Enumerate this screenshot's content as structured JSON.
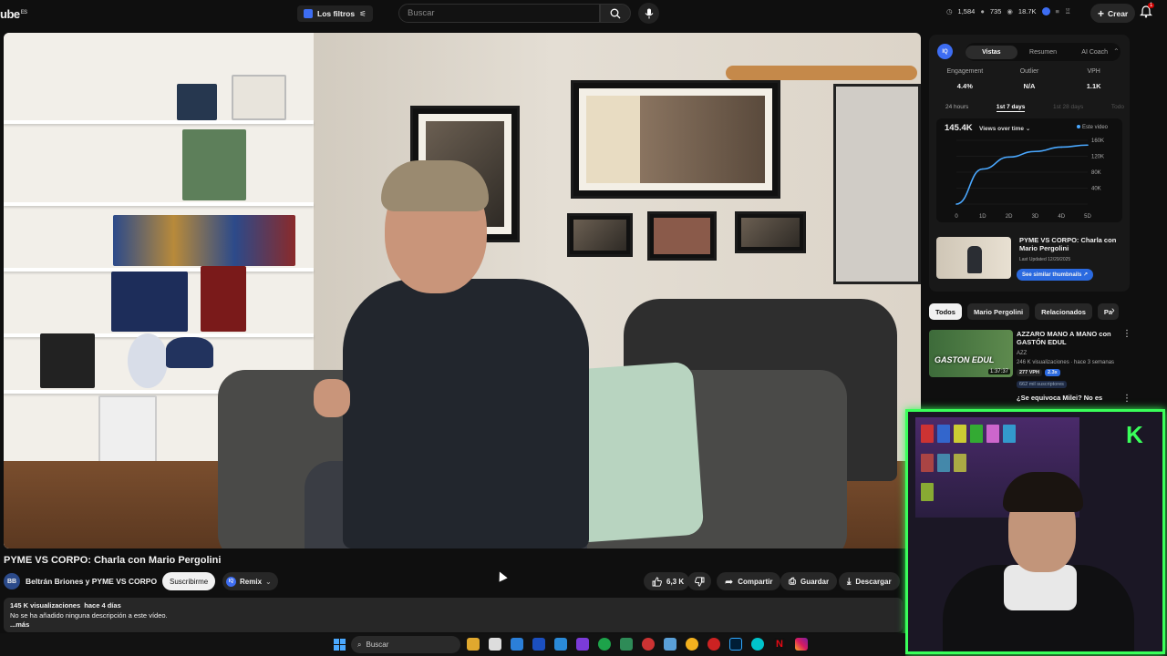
{
  "topbar": {
    "logo": "ube",
    "logo_region": "ES",
    "filters_label": "Los filtros",
    "search_placeholder": "Buscar",
    "stats": [
      "1,584",
      "735",
      "18.7K"
    ],
    "create_label": "Crear",
    "notifications_count": "1"
  },
  "video": {
    "title": "PYME VS CORPO: Charla con Mario Pergolini",
    "channel": "Beltrán Briones y PYME VS CORPO",
    "subscribe_label": "Suscribirme",
    "remix_label": "Remix",
    "likes": "6,3 K",
    "share_label": "Compartir",
    "save_label": "Guardar",
    "download_label": "Descargar"
  },
  "description": {
    "views": "145 K visualizaciones",
    "age": "hace 4 días",
    "text": "No se ha añadido ninguna descripción a este vídeo.",
    "more": "...más"
  },
  "panel": {
    "icon_label": "IQ",
    "tabs": [
      "Vistas",
      "Resumen",
      "AI Coach"
    ],
    "metrics": [
      {
        "label": "Engagement",
        "value": "4.4%"
      },
      {
        "label": "Outlier",
        "value": "N/A"
      },
      {
        "label": "VPH",
        "value": "1.1K"
      }
    ],
    "periods": [
      "24 hours",
      "1st 7 days",
      "1st 28 days",
      "Todo"
    ],
    "chart_total": "145.4K",
    "chart_selector": "Views over time",
    "chart_legend": "Este video",
    "thumb_title": "PYME VS CORPO: Charla con Mario Pergolini",
    "thumb_date": "Last Updated 12/29/2025",
    "similar_label": "See similar thumbnails"
  },
  "chart_data": {
    "type": "line",
    "x": [
      0,
      1,
      2,
      3,
      4,
      5
    ],
    "series": [
      {
        "name": "Este video",
        "values": [
          0,
          88000,
          118000,
          132000,
          143000,
          148000
        ]
      }
    ],
    "x_tick_labels": [
      "0",
      "1D",
      "2D",
      "3D",
      "4D",
      "5D"
    ],
    "y_tick_labels": [
      "160K",
      "120K",
      "80K",
      "40K",
      "0"
    ],
    "ylim": [
      0,
      160000
    ],
    "color": "#4aa8ff"
  },
  "chips": [
    "Todos",
    "Mario Pergolini",
    "Relacionados",
    "Pa"
  ],
  "recommendation": {
    "title": "AZZARO MANO A MANO con GASTÓN EDUL",
    "thumb_text": "GASTON EDUL",
    "duration": "1:37:37",
    "channel": "AZZ",
    "meta": "246 K visualizaciones · hace 3 semanas",
    "vph": "277 VPH",
    "multiplier": "2.3x",
    "subs": "662 mil suscriptores"
  },
  "recommendation2_title": "¿Se equivoca Milei? No es",
  "taskbar": {
    "search_label": "Buscar"
  }
}
